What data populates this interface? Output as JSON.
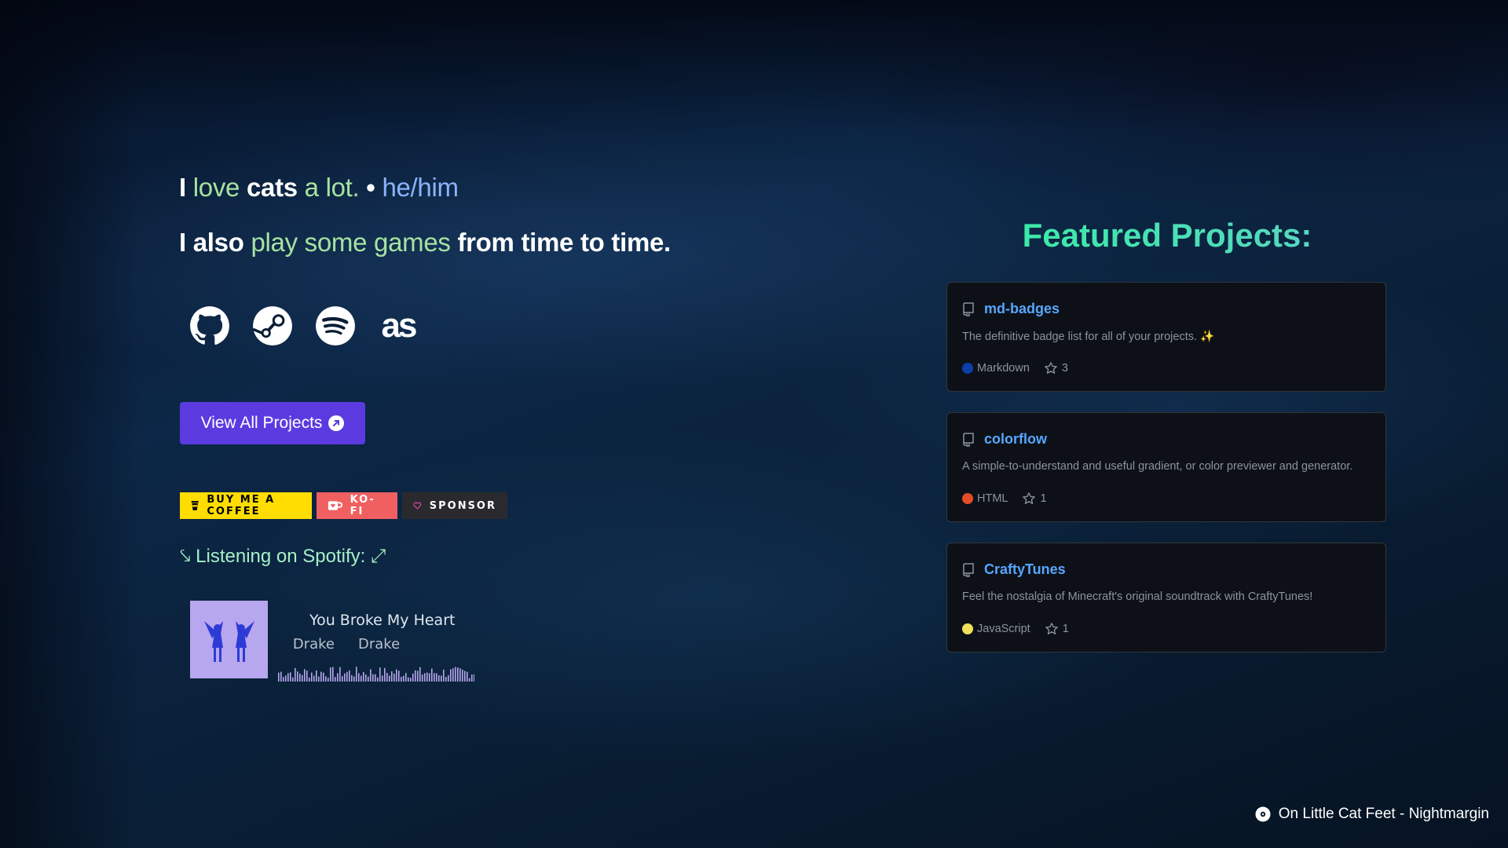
{
  "intro": {
    "line1": {
      "p1": "I ",
      "p2": "love",
      "p3": " cats",
      "p4": " a lot.",
      "p5": " • ",
      "p6": "he/him"
    },
    "line2": {
      "p1": "I also ",
      "p2": "play some games",
      "p3": " from time to time."
    }
  },
  "socials": [
    {
      "name": "github-icon"
    },
    {
      "name": "steam-icon"
    },
    {
      "name": "spotify-icon"
    },
    {
      "name": "lastfm-icon",
      "text": "as"
    }
  ],
  "view_all": {
    "label": "View All Projects"
  },
  "badges": {
    "coffee": "BUY ME A COFFEE",
    "kofi": "KO-FI",
    "sponsor": "SPONSOR"
  },
  "spotify": {
    "heading": "⤥ Listening on Spotify: ⤢",
    "song_title": "You Broke My Heart",
    "artist_fragment": "ke",
    "artist": "Drake",
    "artist_repeat": "Drake"
  },
  "featured": {
    "title": "Featured Projects:",
    "projects": [
      {
        "name": "md-badges",
        "description": "The definitive badge list for all of your projects. ✨",
        "language": "Markdown",
        "language_color": "#0b3ea8",
        "stars": "3"
      },
      {
        "name": "colorflow",
        "description": "A simple-to-understand and useful gradient, or color previewer and generator.",
        "language": "HTML",
        "language_color": "#e34c26",
        "stars": "1"
      },
      {
        "name": "CraftyTunes",
        "description": "Feel the nostalgia of Minecraft's original soundtrack with CraftyTunes!",
        "language": "JavaScript",
        "language_color": "#f1e05a",
        "stars": "1"
      }
    ]
  },
  "now_playing": {
    "text": "On Little Cat Feet - Nightmargin"
  }
}
